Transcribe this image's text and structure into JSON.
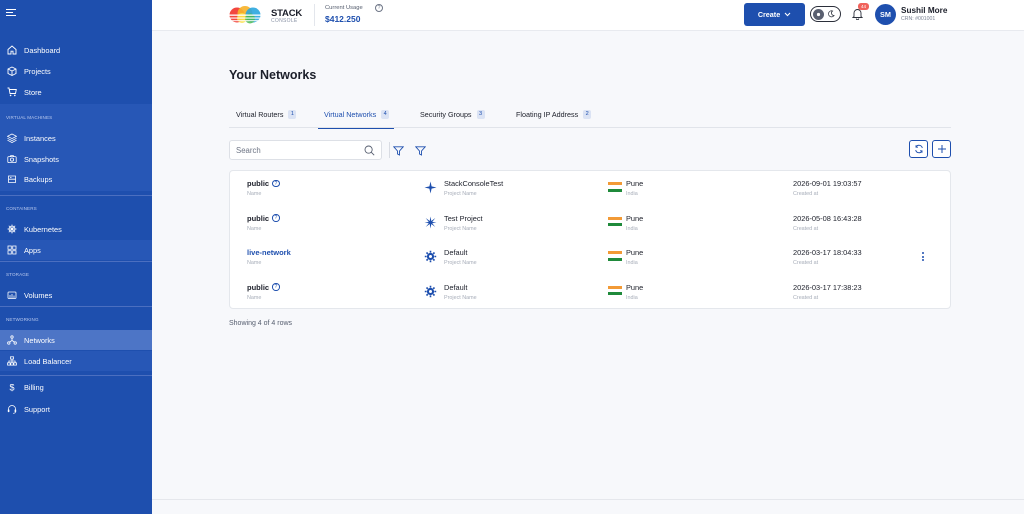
{
  "sidebar": {
    "items": [
      {
        "label": "Dashboard",
        "icon": "home-icon"
      },
      {
        "label": "Projects",
        "icon": "box-icon"
      },
      {
        "label": "Store",
        "icon": "cart-icon"
      },
      {
        "label": "Instances",
        "icon": "layers-icon"
      },
      {
        "label": "Snapshots",
        "icon": "camera-icon"
      },
      {
        "label": "Backups",
        "icon": "database-icon"
      },
      {
        "label": "Kubernetes",
        "icon": "helm-icon"
      },
      {
        "label": "Apps",
        "icon": "grid-icon"
      },
      {
        "label": "Volumes",
        "icon": "disk-icon"
      },
      {
        "label": "Networks",
        "icon": "network-icon"
      },
      {
        "label": "Load Balancer",
        "icon": "sitemap-icon"
      },
      {
        "label": "Billing",
        "icon": "dollar-icon"
      },
      {
        "label": "Support",
        "icon": "headset-icon"
      }
    ],
    "sections": {
      "virtual_machines": "VIRTUAL MACHINES",
      "containers": "CONTAINERS",
      "storage": "STORAGE",
      "networking": "NETWORKING"
    },
    "active": "Networks"
  },
  "header": {
    "logo_text": "STACK",
    "logo_sub": "CONSOLE",
    "usage_label": "Current Usage",
    "usage_value": "$412.250",
    "create_label": "Create",
    "notification_count": "44",
    "user_initials": "SM",
    "user_name": "Sushil More",
    "user_crn": "CRN: #001001"
  },
  "main": {
    "title": "Your Networks",
    "tabs": [
      {
        "label": "Virtual Routers",
        "count": "1"
      },
      {
        "label": "Virtual Networks",
        "count": "4"
      },
      {
        "label": "Security Groups",
        "count": "3"
      },
      {
        "label": "Floating IP Address",
        "count": "2"
      }
    ],
    "active_tab": "Virtual Networks",
    "search_placeholder": "Search",
    "showing_text": "Showing 4 of 4 rows"
  },
  "table": {
    "sub_labels": {
      "name": "Name",
      "project": "Project Name",
      "created": "Created at"
    },
    "rows": [
      {
        "name": "public",
        "help": true,
        "project": "StackConsoleTest",
        "project_icon": "sparkle-icon",
        "city": "Pune",
        "country": "India",
        "created": "2026-09-01 19:03:57",
        "menu": false
      },
      {
        "name": "public",
        "help": true,
        "project": "Test Project",
        "project_icon": "asterisk-star-icon",
        "city": "Pune",
        "country": "India",
        "created": "2026-05-08 16:43:28",
        "menu": false
      },
      {
        "name": "live-network",
        "help": false,
        "project": "Default",
        "project_icon": "gear-icon",
        "city": "Pune",
        "country": "India",
        "created": "2026-03-17 18:04:33",
        "menu": true
      },
      {
        "name": "public",
        "help": true,
        "project": "Default",
        "project_icon": "gear-icon",
        "city": "Pune",
        "country": "India",
        "created": "2026-03-17 17:38:23",
        "menu": false
      }
    ]
  },
  "colors": {
    "sidebar": "#1e4fae",
    "accent": "#1e4fae",
    "badge": "#f0625b",
    "flag_saffron": "#f29a36",
    "flag_green": "#1f8a3b"
  }
}
